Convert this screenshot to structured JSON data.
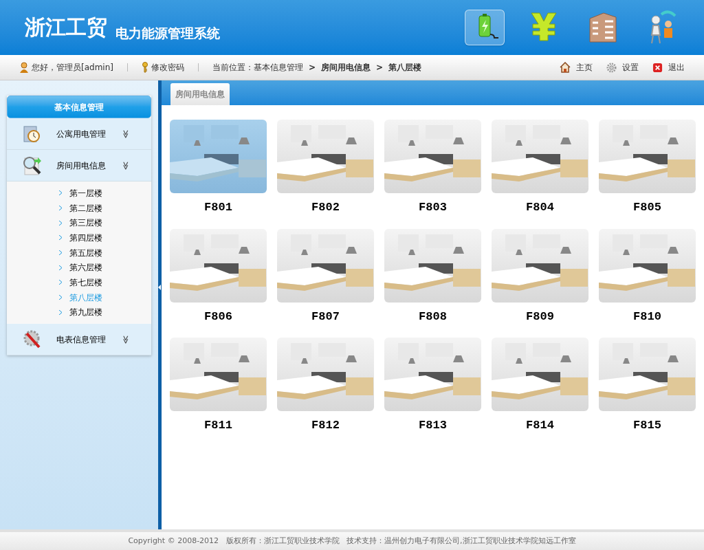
{
  "header": {
    "logo": "浙江工贸",
    "system_name": "电力能源管理系统",
    "tools": [
      {
        "kind": "battery",
        "selected": true
      },
      {
        "kind": "yen",
        "selected": false
      },
      {
        "kind": "building",
        "selected": false
      },
      {
        "kind": "worker",
        "selected": false
      }
    ]
  },
  "toolbar": {
    "greeting": "您好，管理员[admin]",
    "change_password": "修改密码",
    "breadcrumb": [
      {
        "text": "当前位置：基本信息管理",
        "current": false
      },
      {
        "text": "房间用电信息",
        "current": true
      },
      {
        "text": "第八层楼",
        "current": true
      }
    ],
    "separator": ">",
    "links": [
      {
        "kind": "home",
        "label": "主页"
      },
      {
        "kind": "settings",
        "label": "设置"
      },
      {
        "kind": "exit",
        "label": "退出"
      }
    ]
  },
  "sidebar": {
    "title": "基本信息管理",
    "groups": [
      {
        "kind": "clock",
        "label": "公寓用电管理",
        "toggle": "≫"
      },
      {
        "kind": "search",
        "label": "房间用电信息",
        "toggle": "≫",
        "children": [
          {
            "label": "第一层楼",
            "selected": false
          },
          {
            "label": "第二层楼",
            "selected": false
          },
          {
            "label": "第三层楼",
            "selected": false
          },
          {
            "label": "第四层楼",
            "selected": false
          },
          {
            "label": "第五层楼",
            "selected": false
          },
          {
            "label": "第六层楼",
            "selected": false
          },
          {
            "label": "第七层楼",
            "selected": false
          },
          {
            "label": "第八层楼",
            "selected": true
          },
          {
            "label": "第九层楼",
            "selected": false
          }
        ]
      },
      {
        "kind": "tools",
        "label": "电表信息管理",
        "toggle": "≫"
      }
    ]
  },
  "content": {
    "tab": "房间用电信息",
    "rooms": [
      {
        "label": "F801",
        "selected": true
      },
      {
        "label": "F802",
        "selected": false
      },
      {
        "label": "F803",
        "selected": false
      },
      {
        "label": "F804",
        "selected": false
      },
      {
        "label": "F805",
        "selected": false
      },
      {
        "label": "F806",
        "selected": false
      },
      {
        "label": "F807",
        "selected": false
      },
      {
        "label": "F808",
        "selected": false
      },
      {
        "label": "F809",
        "selected": false
      },
      {
        "label": "F810",
        "selected": false
      },
      {
        "label": "F811",
        "selected": false
      },
      {
        "label": "F812",
        "selected": false
      },
      {
        "label": "F813",
        "selected": false
      },
      {
        "label": "F814",
        "selected": false
      },
      {
        "label": "F815",
        "selected": false
      }
    ]
  },
  "footer": "Copyright © 2008-2012   版权所有：浙江工贸职业技术学院   技术支持：温州创力电子有限公司,浙江工贸职业技术学院知远工作室"
}
